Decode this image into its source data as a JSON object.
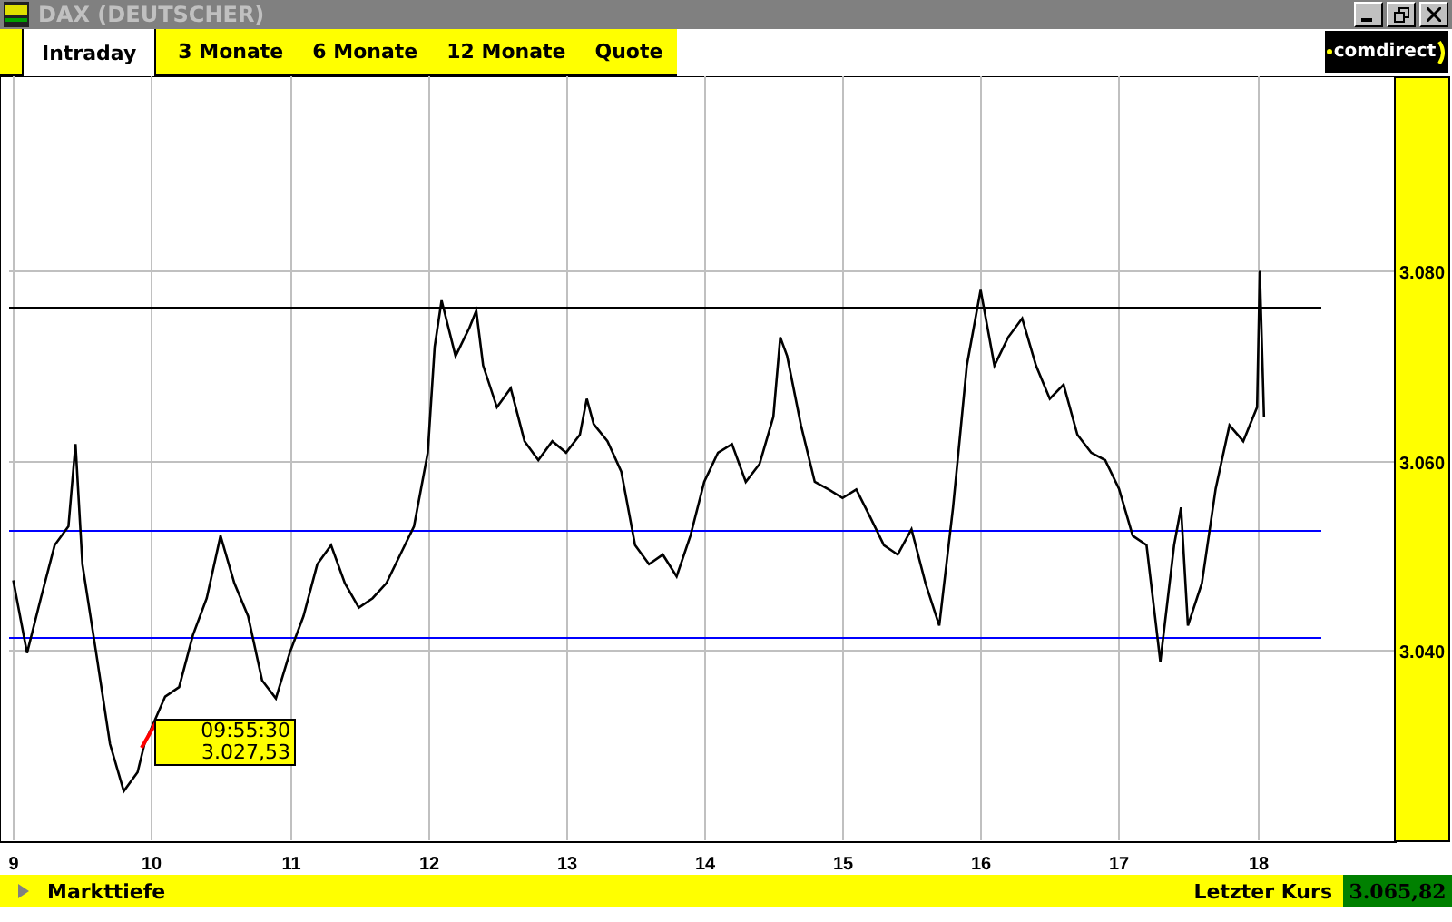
{
  "window": {
    "title": "DAX (DEUTSCHER)"
  },
  "tabs": [
    {
      "label": "Intraday",
      "selected": true
    },
    {
      "label": "3 Monate",
      "selected": false
    },
    {
      "label": "6 Monate",
      "selected": false
    },
    {
      "label": "12 Monate",
      "selected": false
    },
    {
      "label": "Quote",
      "selected": false
    }
  ],
  "logo": {
    "text": "comdirect"
  },
  "chart": {
    "chart_data": {
      "type": "line",
      "xlim": [
        8.97,
        18.99
      ],
      "ylim": [
        3019.8,
        3100.6
      ],
      "xticks": [
        {
          "value": 9,
          "label": "9"
        },
        {
          "value": 10,
          "label": "10"
        },
        {
          "value": 11,
          "label": "11"
        },
        {
          "value": 12,
          "label": "12"
        },
        {
          "value": 13,
          "label": "13"
        },
        {
          "value": 14,
          "label": "14"
        },
        {
          "value": 15,
          "label": "15"
        },
        {
          "value": 16,
          "label": "16"
        },
        {
          "value": 17,
          "label": "17"
        },
        {
          "value": 18,
          "label": "18"
        }
      ],
      "yticks": [
        {
          "value": 3040,
          "label": "3.040"
        },
        {
          "value": 3060,
          "label": "3.060"
        },
        {
          "value": 3080,
          "label": "3.080"
        }
      ],
      "grid": true,
      "x": [
        9.0,
        9.1,
        9.2,
        9.3,
        9.4,
        9.45,
        9.5,
        9.6,
        9.7,
        9.8,
        9.9,
        9.95,
        10.1,
        10.2,
        10.3,
        10.4,
        10.5,
        10.6,
        10.7,
        10.8,
        10.9,
        11.0,
        11.1,
        11.2,
        11.3,
        11.4,
        11.5,
        11.6,
        11.7,
        11.8,
        11.9,
        12.0,
        12.05,
        12.1,
        12.2,
        12.3,
        12.35,
        12.4,
        12.5,
        12.6,
        12.7,
        12.8,
        12.9,
        13.0,
        13.1,
        13.15,
        13.2,
        13.3,
        13.4,
        13.5,
        13.6,
        13.7,
        13.8,
        13.9,
        14.0,
        14.1,
        14.2,
        14.3,
        14.4,
        14.5,
        14.55,
        14.6,
        14.7,
        14.8,
        14.9,
        15.0,
        15.1,
        15.2,
        15.3,
        15.4,
        15.5,
        15.6,
        15.7,
        15.8,
        15.9,
        16.0,
        16.1,
        16.2,
        16.3,
        16.4,
        16.5,
        16.6,
        16.7,
        16.8,
        16.9,
        17.0,
        17.1,
        17.2,
        17.3,
        17.4,
        17.45,
        17.5,
        17.6,
        17.7,
        17.8,
        17.9,
        18.0,
        18.02,
        18.05
      ],
      "series": [
        {
          "color": "#000000",
          "values": [
            3047.3,
            3039.6,
            3045.4,
            3051,
            3053,
            3061.7,
            3049,
            3039.6,
            3030,
            3025,
            3027,
            3030,
            3035,
            3036,
            3041.5,
            3045.4,
            3052,
            3047,
            3043.5,
            3036.7,
            3034.8,
            3039.6,
            3043.5,
            3049,
            3051,
            3047,
            3044.4,
            3045.4,
            3047,
            3050,
            3053,
            3060.8,
            3072,
            3076.9,
            3071,
            3074,
            3075.8,
            3070,
            3065.6,
            3067.6,
            3062,
            3060,
            3062,
            3060.8,
            3062.7,
            3066.5,
            3063.8,
            3062,
            3058.8,
            3051,
            3049,
            3050,
            3047.7,
            3052,
            3057.7,
            3060.8,
            3061.7,
            3057.7,
            3059.6,
            3064.6,
            3073,
            3071,
            3063.7,
            3057.7,
            3056.9,
            3056,
            3056.9,
            3054,
            3051,
            3050,
            3052.7,
            3047,
            3042.5,
            3055,
            3070,
            3078,
            3070,
            3073,
            3075,
            3070,
            3066.5,
            3068,
            3062.7,
            3060.8,
            3060,
            3057,
            3052,
            3051,
            3038.7,
            3051,
            3055,
            3042.5,
            3047,
            3057,
            3063.7,
            3062,
            3065.6,
            3080,
            3064.6
          ]
        }
      ],
      "ref_lines": [
        {
          "axis": "y",
          "value": 3076.3,
          "color": "#000000"
        },
        {
          "axis": "y",
          "value": 3052.7,
          "color": "#0000ff"
        },
        {
          "axis": "y",
          "value": 3041.2,
          "color": "#0000ff"
        }
      ]
    },
    "tooltip": {
      "time": "09:55:30",
      "value": "3.027,53"
    }
  },
  "footer": {
    "link": "Markttiefe",
    "last_price_label": "Letzter Kurs",
    "last_price": "3.065,82"
  }
}
